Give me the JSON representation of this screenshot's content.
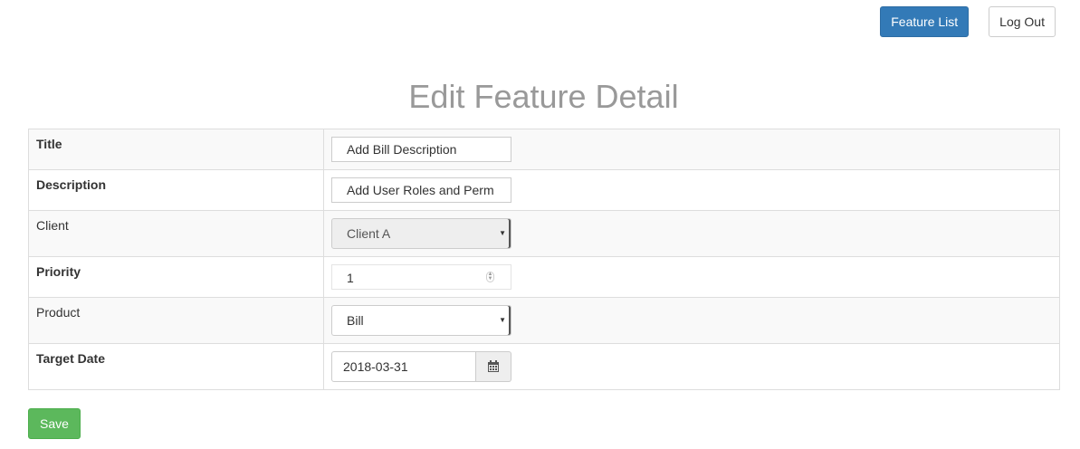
{
  "nav": {
    "feature_list_label": "Feature List",
    "logout_label": "Log Out"
  },
  "page": {
    "title": "Edit Feature Detail"
  },
  "form": {
    "title_label": "Title",
    "title_value": "Add Bill Description",
    "description_label": "Description",
    "description_value": "Add User Roles and Perm",
    "client_label": "Client",
    "client_value": "Client A",
    "priority_label": "Priority",
    "priority_value": "1",
    "product_label": "Product",
    "product_value": "Bill",
    "target_date_label": "Target Date",
    "target_date_value": "2018-03-31",
    "save_label": "Save"
  },
  "colors": {
    "primary": "#337ab7",
    "success": "#5cb85c",
    "title_gray": "#999999"
  }
}
